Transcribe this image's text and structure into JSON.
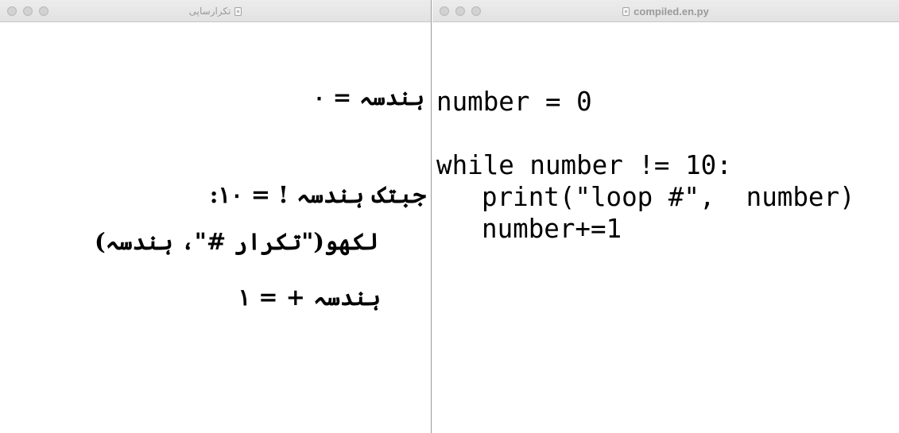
{
  "left_window": {
    "title": "تکرارساپی",
    "lines": [
      "ہندسہ = ۰",
      "جبتک ہندسہ ! = ۱۰:",
      "لکھو(\"تکرار #\"، ہندسہ)",
      "ہندسہ + = ۱"
    ]
  },
  "right_window": {
    "title": "compiled.en.py",
    "code_lines": [
      "number = 0",
      "",
      "while number != 10:",
      "print(\"loop #\",  number)",
      "number+=1"
    ]
  }
}
